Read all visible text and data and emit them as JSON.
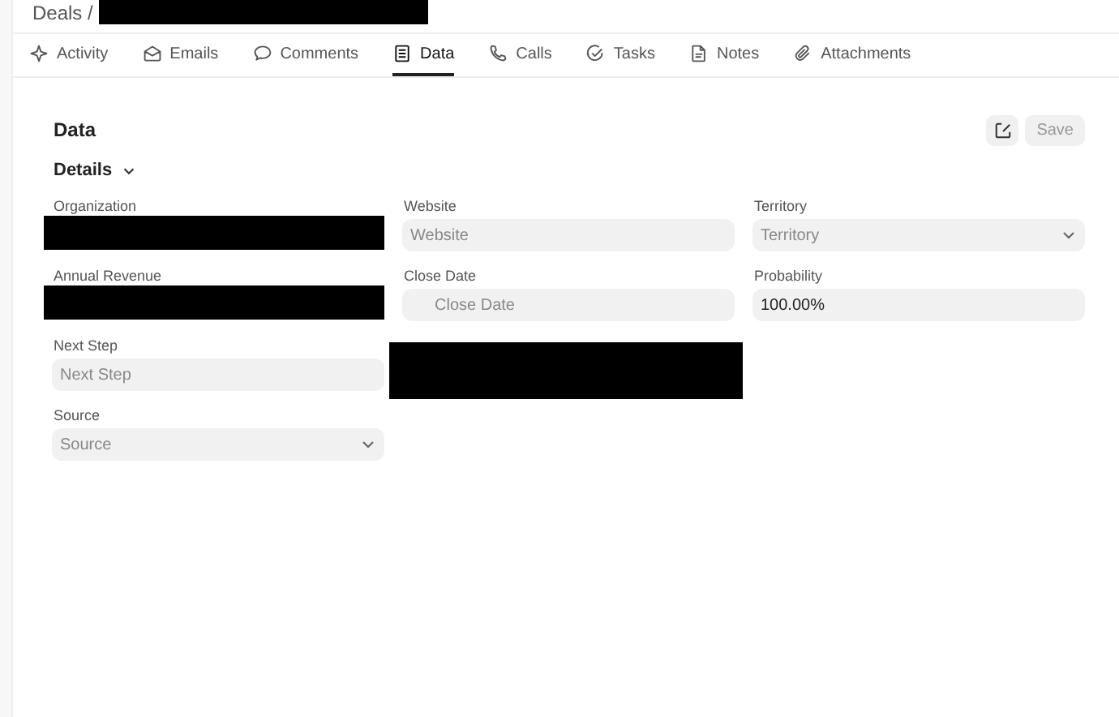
{
  "header": {
    "breadcrumb": "Deals /",
    "redacted": true
  },
  "tabs": [
    {
      "label": "Activity",
      "selected": false
    },
    {
      "label": "Emails",
      "selected": false
    },
    {
      "label": "Comments",
      "selected": false
    },
    {
      "label": "Data",
      "selected": true
    },
    {
      "label": "Calls",
      "selected": false
    },
    {
      "label": "Tasks",
      "selected": false
    },
    {
      "label": "Notes",
      "selected": false
    },
    {
      "label": "Attachments",
      "selected": false
    }
  ],
  "panel": {
    "title": "Data",
    "save_button": {
      "label": "Save",
      "disabled": true
    },
    "section": {
      "title": "Details",
      "expanded": true
    },
    "columns": [
      [
        {
          "label": "Organization",
          "kind": "redacted"
        },
        {
          "label": "Annual Revenue",
          "kind": "redacted"
        },
        {
          "label": "Next Step",
          "kind": "text",
          "placeholder": "Next Step"
        },
        {
          "label": "Source",
          "kind": "select",
          "placeholder": "Source"
        }
      ],
      [
        {
          "label": "Website",
          "kind": "text",
          "placeholder": "Website"
        },
        {
          "label": "Close Date",
          "kind": "date",
          "placeholder": "Close Date"
        },
        {
          "kind": "redacted-tall"
        }
      ],
      [
        {
          "label": "Territory",
          "kind": "select",
          "placeholder": "Territory"
        },
        {
          "label": "Probability",
          "kind": "text",
          "value": "100.00%"
        }
      ]
    ]
  }
}
